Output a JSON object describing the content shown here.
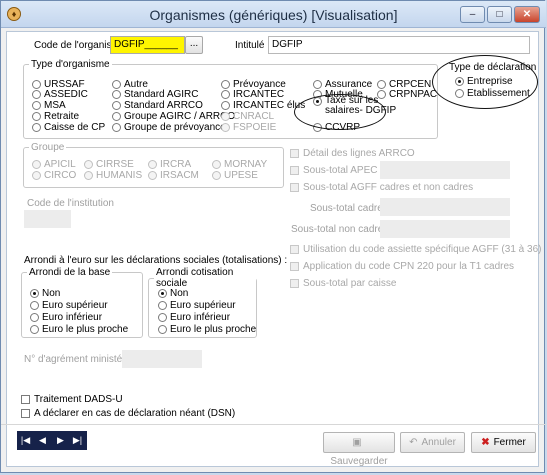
{
  "window": {
    "title": "Organismes (génériques)   [Visualisation]",
    "app_icon": "app-shield-icon",
    "controls": {
      "minimize": "–",
      "maximize": "□",
      "close": "✕"
    }
  },
  "form": {
    "code_label": "Code de l'organisme",
    "code_value": "DGFIP______",
    "browse_label": "...",
    "intitule_label": "Intitulé",
    "intitule_value": "DGFIP"
  },
  "type_organisme": {
    "legend": "Type d'organisme",
    "options": [
      {
        "label": "URSSAF",
        "selected": false,
        "disabled": false
      },
      {
        "label": "Autre",
        "selected": false,
        "disabled": false
      },
      {
        "label": "Prévoyance",
        "selected": false,
        "disabled": false
      },
      {
        "label": "Assurance",
        "selected": false,
        "disabled": false
      },
      {
        "label": "CRPCEN",
        "selected": false,
        "disabled": false
      },
      {
        "label": "ASSEDIC",
        "selected": false,
        "disabled": false
      },
      {
        "label": "Standard AGIRC",
        "selected": false,
        "disabled": false
      },
      {
        "label": "IRCANTEC",
        "selected": false,
        "disabled": false
      },
      {
        "label": "Mutuelle",
        "selected": false,
        "disabled": false
      },
      {
        "label": "CRPNPAC",
        "selected": false,
        "disabled": false
      },
      {
        "label": "MSA",
        "selected": false,
        "disabled": false
      },
      {
        "label": "Standard ARRCO",
        "selected": false,
        "disabled": false
      },
      {
        "label": "IRCANTEC élus",
        "selected": false,
        "disabled": false
      },
      {
        "label": "Taxe sur les",
        "label2": "salaires- DGFIP",
        "selected": true,
        "disabled": false
      },
      {
        "label": "Retraite",
        "selected": false,
        "disabled": false
      },
      {
        "label": "Groupe AGIRC / ARRCO",
        "selected": false,
        "disabled": false
      },
      {
        "label": "CNRACL",
        "selected": false,
        "disabled": true
      },
      {
        "label": "Caisse de CP",
        "selected": false,
        "disabled": false
      },
      {
        "label": "Groupe de prévoyance",
        "selected": false,
        "disabled": false
      },
      {
        "label": "FSPOEIE",
        "selected": false,
        "disabled": true
      },
      {
        "label": "CCVRP",
        "selected": false,
        "disabled": false
      }
    ]
  },
  "type_declaration": {
    "legend": "Type de déclaration",
    "options": [
      {
        "label": "Entreprise",
        "selected": true
      },
      {
        "label": "Etablissement",
        "selected": false
      }
    ]
  },
  "groupe": {
    "legend": "Groupe",
    "options": [
      "APICIL",
      "CIRRSE",
      "IRCRA",
      "MORNAY",
      "CIRCO",
      "HUMANIS",
      "IRSACM",
      "UPESE"
    ]
  },
  "institution": {
    "label": "Code de l'institution",
    "value": ""
  },
  "checks_right": [
    {
      "label": "Détail des lignes ARRCO"
    },
    {
      "label": "Sous-total APEC"
    },
    {
      "label": "Sous-total AGFF cadres et non cadres"
    }
  ],
  "subtotals": [
    {
      "label": "Sous-total cadres",
      "value": ""
    },
    {
      "label": "Sous-total non cadres",
      "value": ""
    }
  ],
  "checks_right2": [
    {
      "label": "Utilisation du code assiette spécifique AGFF (31 à 36)"
    },
    {
      "label": "Application du code CPN 220 pour la T1 cadres"
    },
    {
      "label": "Sous-total par caisse"
    }
  ],
  "arrondi": {
    "title": "Arrondi à l'euro sur les déclarations sociales (totalisations) :",
    "base": {
      "legend": "Arrondi de la base",
      "options": [
        {
          "label": "Non",
          "selected": true
        },
        {
          "label": "Euro supérieur",
          "selected": false
        },
        {
          "label": "Euro inférieur",
          "selected": false
        },
        {
          "label": "Euro le plus proche",
          "selected": false
        }
      ]
    },
    "cotisation": {
      "legend": "Arrondi cotisation sociale",
      "options": [
        {
          "label": "Non",
          "selected": true
        },
        {
          "label": "Euro supérieur",
          "selected": false
        },
        {
          "label": "Euro inférieur",
          "selected": false
        },
        {
          "label": "Euro le plus proche",
          "selected": false
        }
      ]
    }
  },
  "agrement": {
    "label": "N° d'agrément ministériel",
    "value": ""
  },
  "bottom_checks": [
    {
      "label": "Traitement DADS-U",
      "checked": false
    },
    {
      "label": "A déclarer en cas de déclaration néant (DSN)",
      "checked": false
    }
  ],
  "nav": {
    "first": "|◀",
    "prev": "◀",
    "next": "▶",
    "last": "▶|"
  },
  "buttons": {
    "save": "Sauvegarder",
    "cancel": "Annuler",
    "close": "Fermer",
    "save_icon": "floppy-disk-icon",
    "cancel_icon": "undo-arrow-icon",
    "close_icon": "red-x-icon",
    "close_icon_color": "#cc1f1f"
  }
}
